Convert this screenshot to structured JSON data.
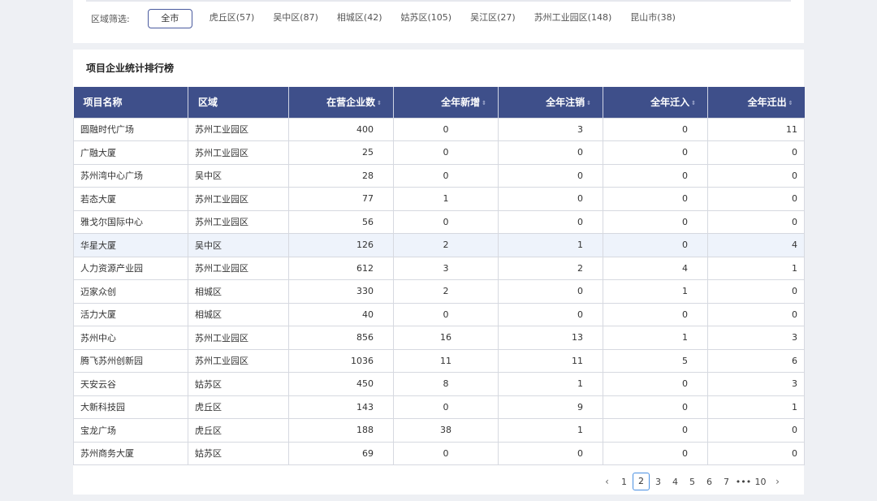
{
  "filter": {
    "label": "区域筛选:",
    "options": [
      "全市",
      "虎丘区(57)",
      "吴中区(87)",
      "相城区(42)",
      "姑苏区(105)",
      "吴江区(27)",
      "苏州工业园区(148)",
      "昆山市(38)"
    ],
    "selected": "全市"
  },
  "ranking": {
    "title": "项目企业统计排行榜",
    "columns": [
      "项目名称",
      "区域",
      "在营企业数",
      "全年新增",
      "全年注销",
      "全年迁入",
      "全年迁出"
    ],
    "sort_icon": "⇕",
    "rows": [
      [
        "圆融时代广场",
        "苏州工业园区",
        "400",
        "0",
        "3",
        "0",
        "11"
      ],
      [
        "广融大厦",
        "苏州工业园区",
        "25",
        "0",
        "0",
        "0",
        "0"
      ],
      [
        "苏州湾中心广场",
        "吴中区",
        "28",
        "0",
        "0",
        "0",
        "0"
      ],
      [
        "若态大厦",
        "苏州工业园区",
        "77",
        "1",
        "0",
        "0",
        "0"
      ],
      [
        "雅戈尔国际中心",
        "苏州工业园区",
        "56",
        "0",
        "0",
        "0",
        "0"
      ],
      [
        "华星大厦",
        "吴中区",
        "126",
        "2",
        "1",
        "0",
        "4"
      ],
      [
        "人力资源产业园",
        "苏州工业园区",
        "612",
        "3",
        "2",
        "4",
        "1"
      ],
      [
        "迈家众创",
        "相城区",
        "330",
        "2",
        "0",
        "1",
        "0"
      ],
      [
        "活力大厦",
        "相城区",
        "40",
        "0",
        "0",
        "0",
        "0"
      ],
      [
        "苏州中心",
        "苏州工业园区",
        "856",
        "16",
        "13",
        "1",
        "3"
      ],
      [
        "腾飞苏州创新园",
        "苏州工业园区",
        "1036",
        "11",
        "11",
        "5",
        "6"
      ],
      [
        "天安云谷",
        "姑苏区",
        "450",
        "8",
        "1",
        "0",
        "3"
      ],
      [
        "大新科技园",
        "虎丘区",
        "143",
        "0",
        "9",
        "0",
        "1"
      ],
      [
        "宝龙广场",
        "虎丘区",
        "188",
        "38",
        "1",
        "0",
        "0"
      ],
      [
        "苏州商务大厦",
        "姑苏区",
        "69",
        "0",
        "0",
        "0",
        "0"
      ]
    ],
    "highlighted_row_index": 5
  },
  "pagination": {
    "prev": "‹",
    "next": "›",
    "pages": [
      "1",
      "2",
      "3",
      "4",
      "5",
      "6",
      "7"
    ],
    "ellipsis": "•••",
    "last": "10",
    "current": "2"
  },
  "colors": {
    "header_bg": "#3e4f8a",
    "row_highlight": "#eef3fb",
    "active_page_border": "#4a90e2"
  }
}
